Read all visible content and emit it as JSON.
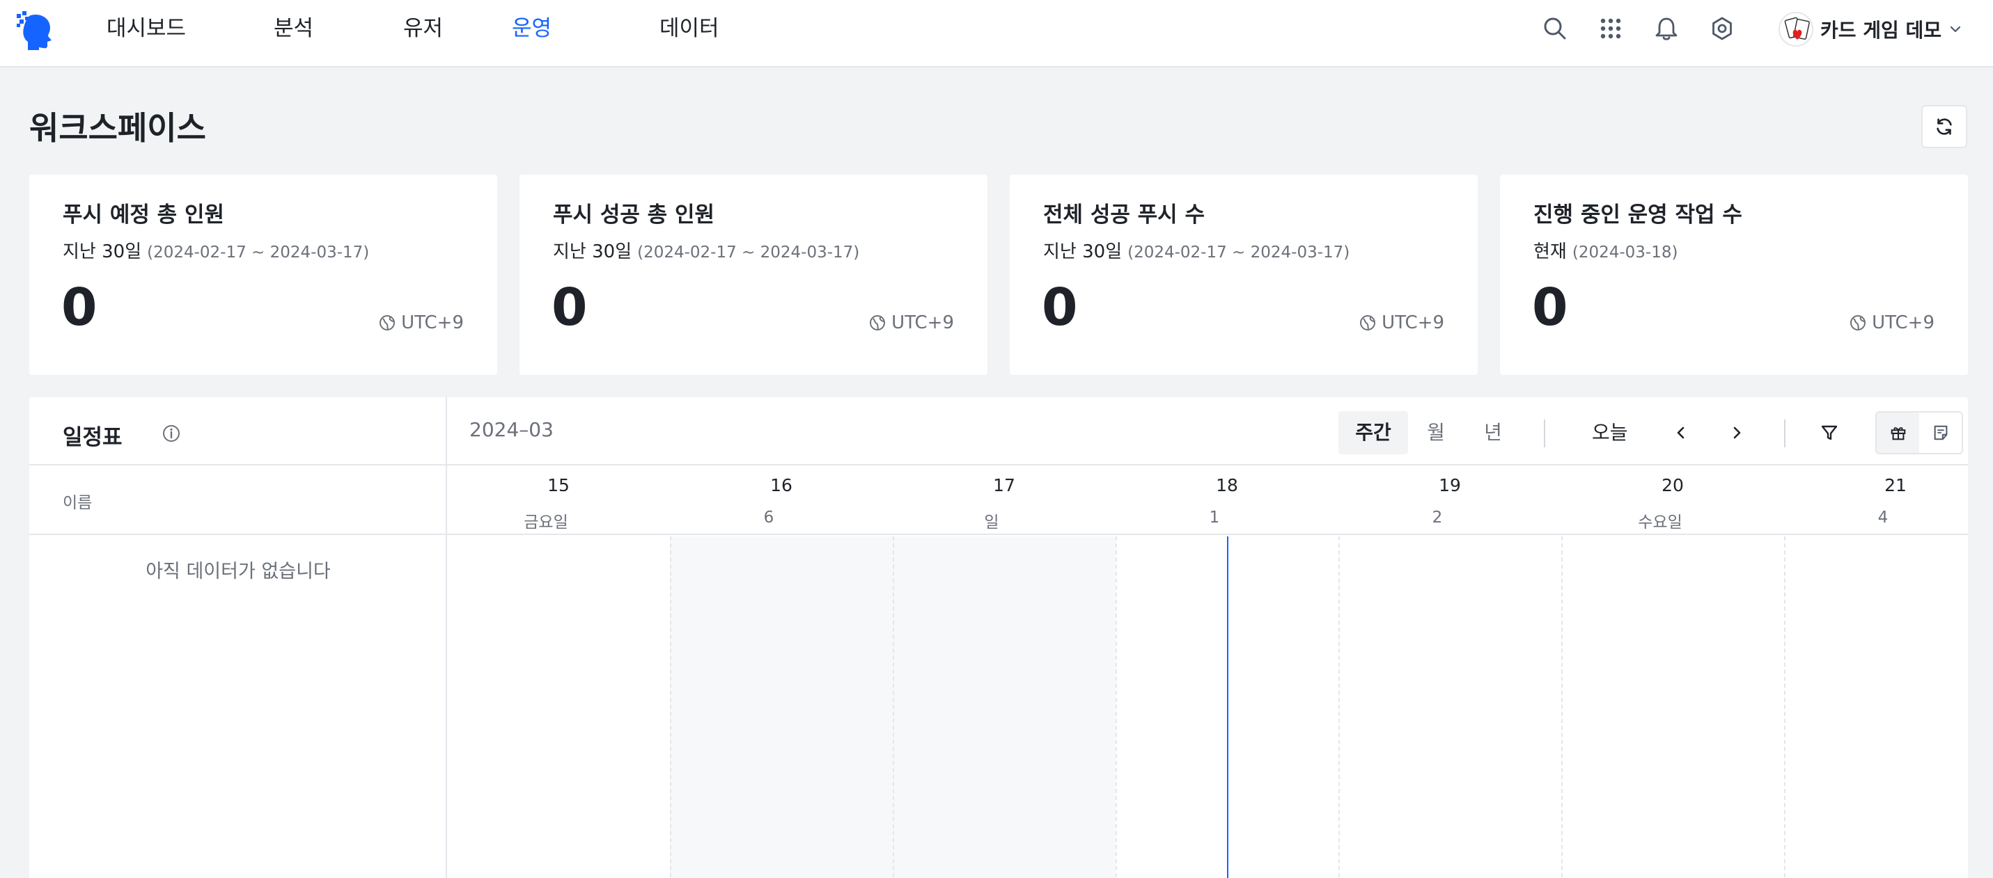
{
  "nav": {
    "items": [
      "대시보드",
      "분석",
      "유저",
      "운영",
      "데이터"
    ],
    "active_index": 3,
    "icons": [
      "search-icon",
      "apps-grid-icon",
      "bell-icon",
      "gear-icon"
    ]
  },
  "project": {
    "name": "카드 게임 데모"
  },
  "page": {
    "title": "워크스페이스"
  },
  "cards": [
    {
      "title": "푸시 예정 총 인원",
      "period": "지난 30일",
      "range": "(2024-02-17 ~ 2024-03-17)",
      "value": "0",
      "tz": "UTC+9"
    },
    {
      "title": "푸시 성공 총 인원",
      "period": "지난 30일",
      "range": "(2024-02-17 ~ 2024-03-17)",
      "value": "0",
      "tz": "UTC+9"
    },
    {
      "title": "전체 성공 푸시 수",
      "period": "지난 30일",
      "range": "(2024-02-17 ~ 2024-03-17)",
      "value": "0",
      "tz": "UTC+9"
    },
    {
      "title": "진행 중인 운영 작업 수",
      "period": "현재",
      "range": "(2024-03-18)",
      "value": "0",
      "tz": "UTC+9"
    }
  ],
  "schedule": {
    "title": "일정표",
    "name_column": "이름",
    "empty_text": "아직 데이터가 없습니다",
    "month": "2024–03",
    "view_options": [
      "주간",
      "월",
      "년"
    ],
    "active_view": "주간",
    "today_label": "오늘",
    "days": [
      {
        "num": "15",
        "sub": "금요일"
      },
      {
        "num": "16",
        "sub": "6"
      },
      {
        "num": "17",
        "sub": "일"
      },
      {
        "num": "18",
        "sub": "1"
      },
      {
        "num": "19",
        "sub": "2"
      },
      {
        "num": "20",
        "sub": "수요일"
      },
      {
        "num": "21",
        "sub": "4"
      }
    ],
    "today_day": "18",
    "colors": {
      "accent": "#1664ff",
      "weekend_shade": "#f7f8fa"
    }
  }
}
